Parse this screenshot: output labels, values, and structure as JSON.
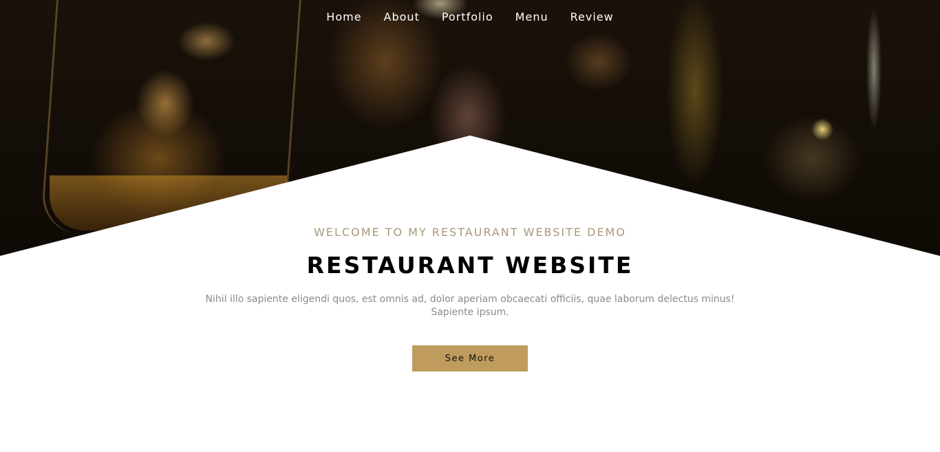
{
  "nav": {
    "items": [
      {
        "label": "Home"
      },
      {
        "label": "About"
      },
      {
        "label": "Portfolio"
      },
      {
        "label": "Menu"
      },
      {
        "label": "Review"
      }
    ]
  },
  "hero": {
    "kicker": "WELCOME TO MY RESTAURANT WEBSITE DEMO",
    "title": "RESTAURANT WEBSITE",
    "description": "Nihil illo sapiente eligendi quos, est omnis ad, dolor aperiam obcaecati officiis, quae laborum delectus minus! Sapiente ipsum.",
    "button_label": "See More"
  },
  "colors": {
    "accent": "#bf9b5e",
    "kicker": "#a89878",
    "nav_text": "#ffffff",
    "title": "#000000",
    "description": "#8a8a8a"
  }
}
